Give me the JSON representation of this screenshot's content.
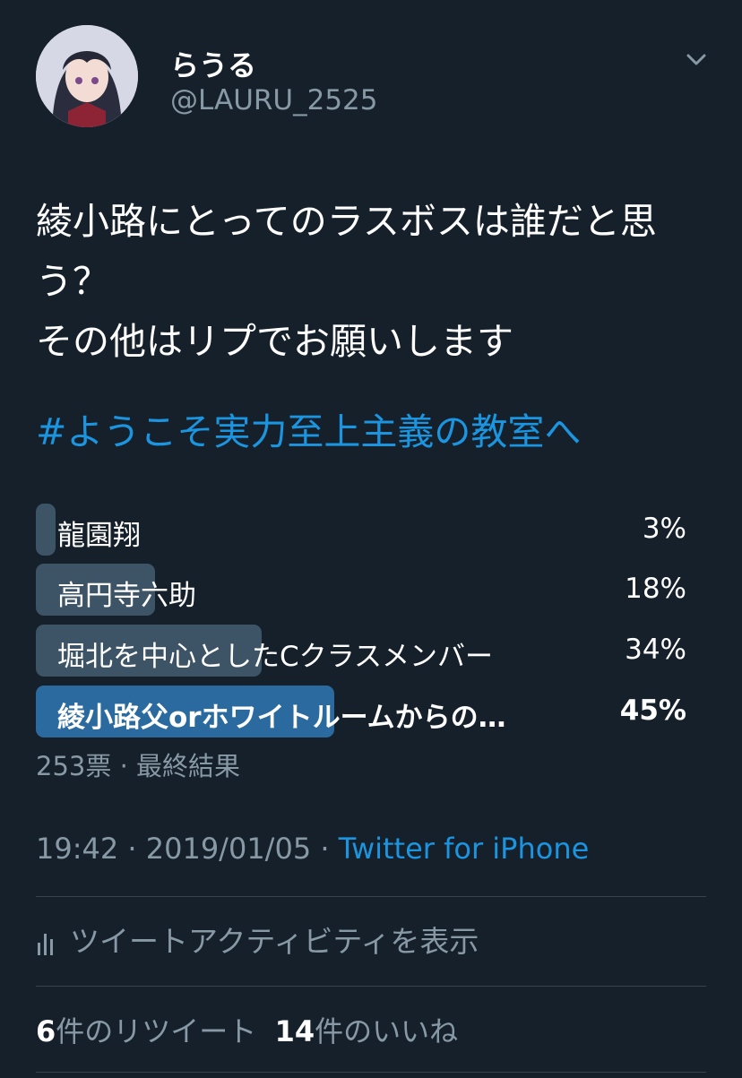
{
  "user": {
    "name": "らうる",
    "handle": "@LAURU_2525"
  },
  "tweet": {
    "text": "綾小路にとってのラスボスは誰だと思う？\nその他はリプでお願いします",
    "hashtag": "#ようこそ実力至上主義の教室へ"
  },
  "poll": {
    "options": [
      {
        "label": "龍園翔",
        "percent_text": "3%",
        "percent": 3
      },
      {
        "label": "高円寺六助",
        "percent_text": "18%",
        "percent": 18
      },
      {
        "label": "堀北を中心としたCクラスメンバー",
        "percent_text": "34%",
        "percent": 34
      },
      {
        "label": "綾小路父orホワイトルームからの…",
        "percent_text": "45%",
        "percent": 45
      }
    ],
    "meta": "253票 · 最終結果"
  },
  "timestamp": {
    "time": "19:42 · 2019/01/05 · ",
    "source": "Twitter for iPhone"
  },
  "activity": {
    "label": "ツイートアクティビティを表示",
    "icon": "analytics-bars-icon"
  },
  "stats": {
    "retweets_count": "6",
    "retweets_label": "件のリツイート",
    "likes_count": "14",
    "likes_label": "件のいいね"
  },
  "colors": {
    "background": "#15202b",
    "link": "#1b95e0",
    "muted": "#8899a6",
    "poll_bar": "#3d5466",
    "poll_bar_winner": "#2b6a9f"
  }
}
